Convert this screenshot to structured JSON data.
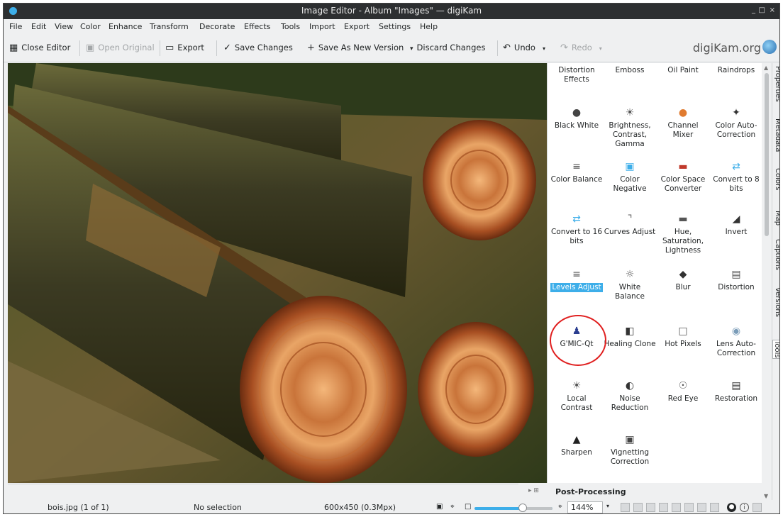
{
  "window": {
    "title": "Image Editor - Album \"Images\" — digiKam",
    "controls": [
      "_",
      "□",
      "×"
    ]
  },
  "menu": [
    "File",
    "Edit",
    "View",
    "Color",
    "Enhance",
    "Transform",
    "Decorate",
    "Effects",
    "Tools",
    "Import",
    "Export",
    "Settings",
    "Help"
  ],
  "toolbar": {
    "close_editor": "Close Editor",
    "open_original": "Open Original",
    "export": "Export",
    "save_changes": "Save Changes",
    "save_as_new": "Save As New Version",
    "discard": "Discard Changes",
    "undo": "Undo",
    "redo": "Redo",
    "brand": "digiKam.org"
  },
  "tools": [
    {
      "label": "Distortion Effects",
      "icon": "distortion-effects-icon"
    },
    {
      "label": "Emboss",
      "icon": "emboss-icon"
    },
    {
      "label": "Oil Paint",
      "icon": "oil-paint-icon"
    },
    {
      "label": "Raindrops",
      "icon": "raindrops-icon"
    },
    {
      "label": "Black White",
      "icon": "black-white-icon"
    },
    {
      "label": "Brightness, Contrast, Gamma",
      "icon": "brightness-icon"
    },
    {
      "label": "Channel Mixer",
      "icon": "channel-mixer-icon"
    },
    {
      "label": "Color Auto-Correction",
      "icon": "magic-wand-icon"
    },
    {
      "label": "Color Balance",
      "icon": "color-balance-icon"
    },
    {
      "label": "Color Negative",
      "icon": "color-negative-icon"
    },
    {
      "label": "Color Space Converter",
      "icon": "color-space-icon"
    },
    {
      "label": "Convert to 8 bits",
      "icon": "convert-8bit-icon"
    },
    {
      "label": "Convert to 16 bits",
      "icon": "convert-16bit-icon"
    },
    {
      "label": "Curves Adjust",
      "icon": "curves-icon"
    },
    {
      "label": "Hue, Saturation, Lightness",
      "icon": "hue-saturation-icon"
    },
    {
      "label": "Invert",
      "icon": "invert-icon"
    },
    {
      "label": "Levels Adjust",
      "icon": "levels-icon"
    },
    {
      "label": "White Balance",
      "icon": "white-balance-icon"
    },
    {
      "label": "Blur",
      "icon": "blur-icon"
    },
    {
      "label": "Distortion",
      "icon": "distortion-icon"
    },
    {
      "label": "G'MIC-Qt",
      "icon": "gmic-icon"
    },
    {
      "label": "Healing Clone",
      "icon": "healing-clone-icon"
    },
    {
      "label": "Hot Pixels",
      "icon": "hot-pixels-icon"
    },
    {
      "label": "Lens Auto-Correction",
      "icon": "lens-icon"
    },
    {
      "label": "Local Contrast",
      "icon": "local-contrast-icon"
    },
    {
      "label": "Noise Reduction",
      "icon": "noise-reduction-icon"
    },
    {
      "label": "Red Eye",
      "icon": "red-eye-icon"
    },
    {
      "label": "Restoration",
      "icon": "restoration-icon"
    },
    {
      "label": "Sharpen",
      "icon": "sharpen-icon"
    },
    {
      "label": "Vignetting Correction",
      "icon": "vignetting-icon"
    }
  ],
  "selected_tool": "Levels Adjust",
  "highlighted_tool": "G'MIC-Qt",
  "side_tabs": [
    "Properties",
    "Metadata",
    "Colors",
    "Map",
    "Captions",
    "Versions",
    "Tools"
  ],
  "active_side_tab": "Tools",
  "post_processing": "Post-Processing",
  "status": {
    "file": "bois.jpg (1 of 1)",
    "selection": "No selection",
    "size": "600x450 (0.3Mpx)",
    "zoom": "144%",
    "zoom_slider_fraction": 0.63
  },
  "colors": {
    "accent": "#3daee9",
    "highlight_ring": "#e02020",
    "titlebar": "#2d2f31"
  }
}
